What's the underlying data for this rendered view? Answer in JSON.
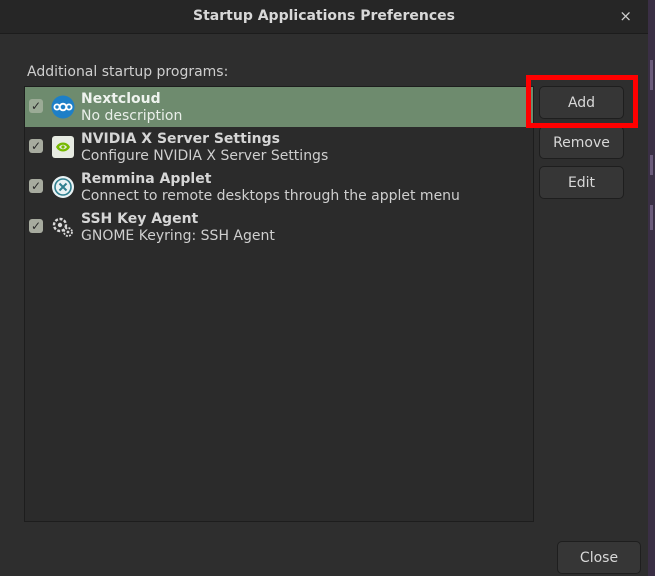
{
  "window": {
    "title": "Startup Applications Preferences",
    "close_glyph": "×"
  },
  "list": {
    "label": "Additional startup programs:",
    "items": [
      {
        "name": "Nextcloud",
        "description": "No description",
        "checked": true,
        "selected": true,
        "icon": "nextcloud-icon"
      },
      {
        "name": "NVIDIA X Server Settings",
        "description": "Configure NVIDIA X Server Settings",
        "checked": true,
        "selected": false,
        "icon": "nvidia-icon"
      },
      {
        "name": "Remmina Applet",
        "description": "Connect to remote desktops through the applet menu",
        "checked": true,
        "selected": false,
        "icon": "remmina-icon"
      },
      {
        "name": "SSH Key Agent",
        "description": "GNOME Keyring: SSH Agent",
        "checked": true,
        "selected": false,
        "icon": "ssh-key-agent-icon"
      }
    ]
  },
  "buttons": {
    "add": "Add",
    "remove": "Remove",
    "edit": "Edit",
    "close": "Close"
  },
  "colors": {
    "selection": "#6e8b6e",
    "highlight": "#ff0000"
  },
  "check_glyph": "✓"
}
